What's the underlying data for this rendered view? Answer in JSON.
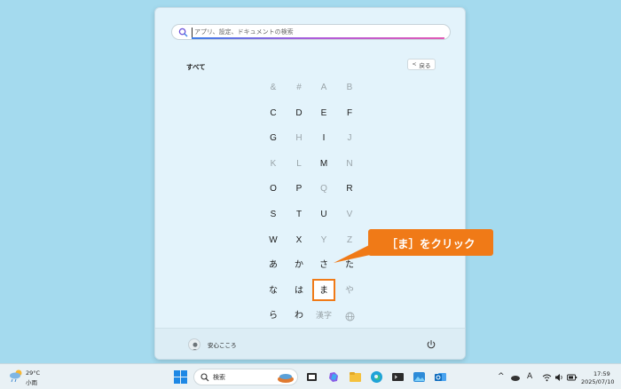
{
  "search": {
    "placeholder": "アプリ、設定、ドキュメントの検索"
  },
  "section_title": "すべて",
  "back_label": "戻る",
  "letters": [
    {
      "ch": "&",
      "dim": true
    },
    {
      "ch": "#",
      "dim": true
    },
    {
      "ch": "A",
      "dim": true
    },
    {
      "ch": "B",
      "dim": true
    },
    {
      "ch": "C",
      "dim": false
    },
    {
      "ch": "D",
      "dim": false
    },
    {
      "ch": "E",
      "dim": false
    },
    {
      "ch": "F",
      "dim": false
    },
    {
      "ch": "G",
      "dim": false
    },
    {
      "ch": "H",
      "dim": true
    },
    {
      "ch": "I",
      "dim": false
    },
    {
      "ch": "J",
      "dim": true
    },
    {
      "ch": "K",
      "dim": true
    },
    {
      "ch": "L",
      "dim": true
    },
    {
      "ch": "M",
      "dim": false
    },
    {
      "ch": "N",
      "dim": true
    },
    {
      "ch": "O",
      "dim": false
    },
    {
      "ch": "P",
      "dim": false
    },
    {
      "ch": "Q",
      "dim": true
    },
    {
      "ch": "R",
      "dim": false
    },
    {
      "ch": "S",
      "dim": false
    },
    {
      "ch": "T",
      "dim": false
    },
    {
      "ch": "U",
      "dim": false
    },
    {
      "ch": "V",
      "dim": true
    },
    {
      "ch": "W",
      "dim": false
    },
    {
      "ch": "X",
      "dim": false
    },
    {
      "ch": "Y",
      "dim": true
    },
    {
      "ch": "Z",
      "dim": true
    },
    {
      "ch": "あ",
      "dim": false
    },
    {
      "ch": "か",
      "dim": false
    },
    {
      "ch": "さ",
      "dim": false
    },
    {
      "ch": "た",
      "dim": false
    },
    {
      "ch": "な",
      "dim": false
    },
    {
      "ch": "は",
      "dim": false
    },
    {
      "ch": "ま",
      "dim": false
    },
    {
      "ch": "や",
      "dim": true
    },
    {
      "ch": "ら",
      "dim": false
    },
    {
      "ch": "わ",
      "dim": false
    },
    {
      "ch": "漢字",
      "dim": true
    },
    {
      "ch": "",
      "dim": true,
      "icon": "globe-icon"
    }
  ],
  "user_name": "安心こころ",
  "callout": "［ま］をクリック",
  "accent_color": "#f07a17",
  "taskbar": {
    "weather_temp": "29°C",
    "weather_desc": "小雨",
    "search_label": "検索",
    "tray_ime": "A",
    "clock_time": "17:59",
    "clock_date": "2025/07/10"
  }
}
